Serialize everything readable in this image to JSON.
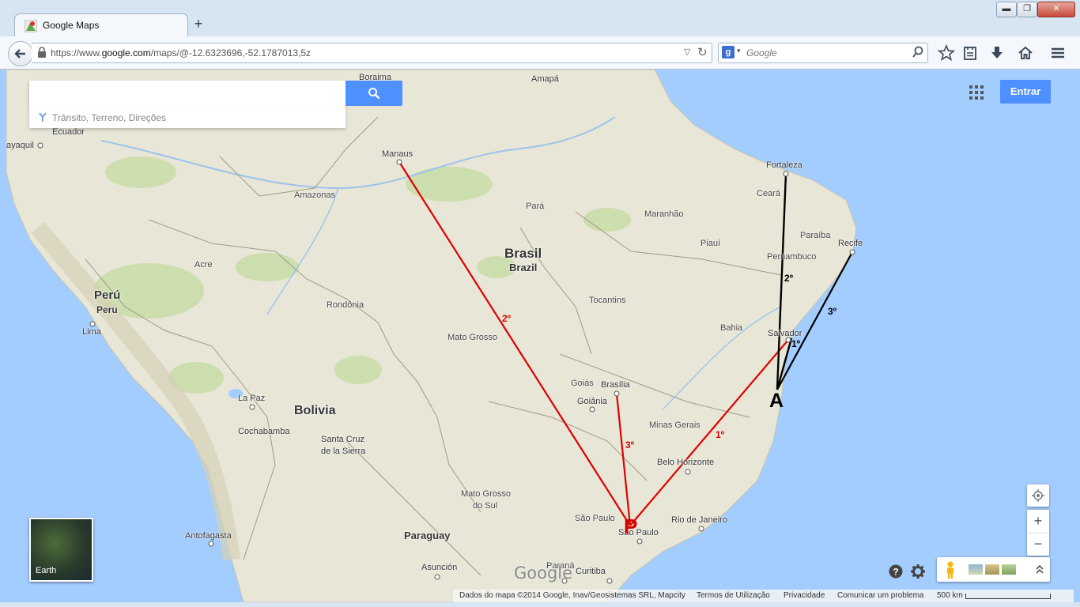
{
  "browser": {
    "tab_title": "Google Maps",
    "new_tab": "+",
    "url_prefix": "https://www.",
    "url_host": "google.com",
    "url_path": "/maps/@-12.6323696,-52.1787013,5z",
    "search_engine_letter": "g",
    "search_placeholder": "Google",
    "window_controls": {
      "minimize": "▬",
      "maximize": "❐",
      "close": "✕"
    }
  },
  "maps": {
    "search_value": "",
    "directions_hint": "Trânsito, Terreno, Direções",
    "signin_label": "Entrar",
    "earth_label": "Earth",
    "zoom_in": "+",
    "zoom_out": "−",
    "google_logo": "Google"
  },
  "map_labels": {
    "boraima": "Boraima",
    "amapa": "Amapá",
    "guayaquil": "ayaquil",
    "ecuador": "Ecuador",
    "manaus": "Manaus",
    "fortaleza": "Fortaleza",
    "ceara": "Ceará",
    "amazonas": "Amazonas",
    "para": "Pará",
    "maranhao": "Maranhão",
    "paraiba": "Paraíba",
    "recife": "Recife",
    "piaui": "Piauí",
    "pernambuco": "Pernambuco",
    "brasil": "Brasil",
    "brazil": "Brazil",
    "acre": "Acre",
    "peru_es": "Perú",
    "peru_en": "Peru",
    "rondonia": "Rondônia",
    "tocantins": "Tocantins",
    "lima": "Lima",
    "bahia": "Bahia",
    "salvador": "Salvador",
    "mato_grosso": "Mato Grosso",
    "goias": "Goiás",
    "brasilia": "Brasília",
    "goiania": "Goiânia",
    "la_paz": "La Paz",
    "bolivia": "Bolivia",
    "minas_gerais": "Minas Gerais",
    "cochabamba": "Cochabamba",
    "santa_cruz_1": "Santa Cruz",
    "santa_cruz_2": "de la Sierra",
    "belo_horizonte": "Belo Horizonte",
    "mato_grosso_sul_1": "Mato Grosso",
    "mato_grosso_sul_2": "do Sul",
    "sao_paulo_state": "São Paulo",
    "rio_de_janeiro": "Rio de Janeiro",
    "antofagasta": "Antofagasta",
    "paraguay": "Paraguay",
    "sao_paulo_city": "São Paulo",
    "asuncion": "Asunción",
    "parana": "Paraná",
    "curitiba": "Curitiba"
  },
  "annotations": {
    "point_p": "P",
    "point_a": "A",
    "red_1": "1º",
    "red_2": "2º",
    "red_3": "3º",
    "black_1": "1º",
    "black_2": "2º",
    "black_3": "3º",
    "red_color": "#e00000",
    "black_color": "#000000"
  },
  "footer": {
    "map_data": "Dados do mapa ©2014 Google, Inav/Geosistemas SRL, Mapcity",
    "terms": "Termos de Utilização",
    "privacy": "Privacidade",
    "report": "Comunicar um problema",
    "scale": "500 km"
  },
  "colors": {
    "ocean": "#a3ccff",
    "land": "#e8e6d6",
    "accent": "#4d90fe"
  }
}
